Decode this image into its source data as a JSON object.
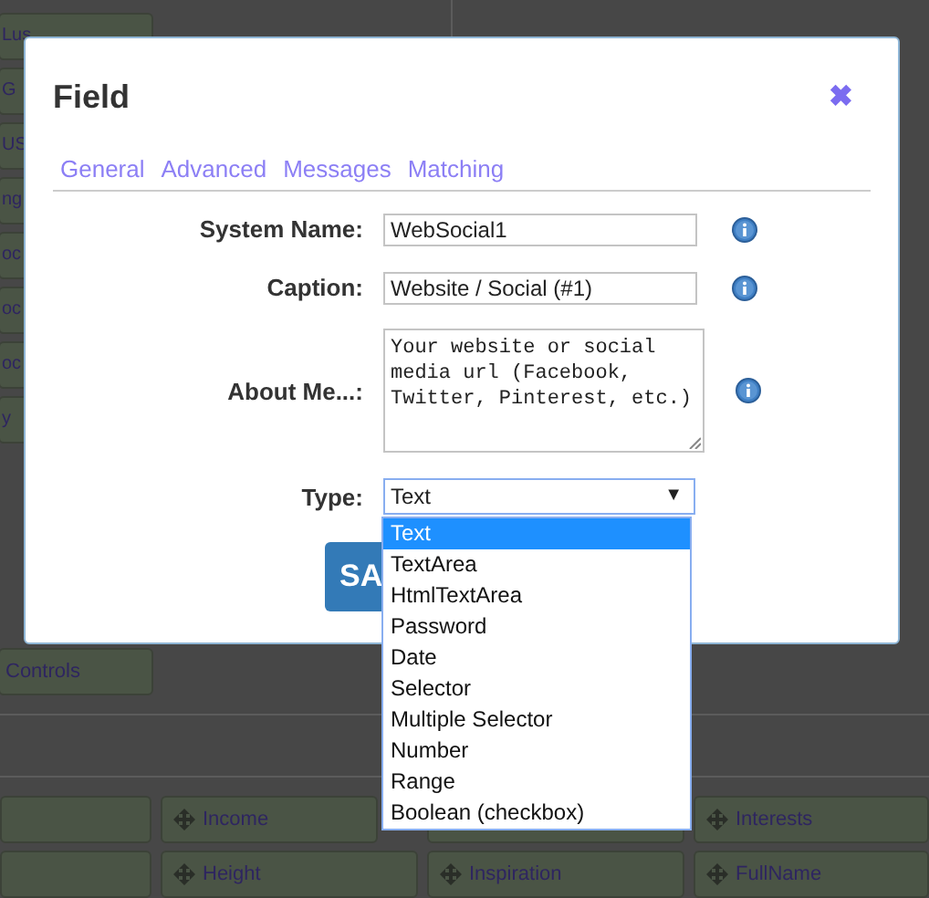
{
  "background": {
    "side_items": [
      "Lus",
      "G",
      "US",
      "ng",
      "oc",
      "oc",
      "oc",
      "y"
    ],
    "controls_label": "Controls",
    "tiles": [
      {
        "kind": "blank"
      },
      {
        "kind": "field",
        "label": "Income"
      },
      {
        "kind": "blank"
      },
      {
        "kind": "field",
        "label": "Interests"
      },
      {
        "kind": "blank"
      },
      {
        "kind": "field",
        "label": "Height"
      },
      {
        "kind": "field",
        "label": "Inspiration"
      },
      {
        "kind": "field",
        "label": "FullName"
      }
    ]
  },
  "dialog": {
    "title": "Field",
    "close": "✖",
    "tabs": [
      {
        "label": "General",
        "selected": false
      },
      {
        "label": "Advanced",
        "selected": false
      },
      {
        "label": "Messages",
        "selected": false
      },
      {
        "label": "Matching",
        "selected": false
      }
    ],
    "fields": [
      {
        "kind": "input",
        "label": "System Name:",
        "value": "WebSocial1"
      },
      {
        "kind": "input",
        "label": "Caption:",
        "value": "Website / Social (#1)"
      },
      {
        "kind": "textarea",
        "label": "About Me...:",
        "value": "Your website or social media url (Facebook, Twitter, Pinterest, etc.)"
      },
      {
        "kind": "select",
        "label": "Type:",
        "value": "Text",
        "caret": "▼"
      }
    ],
    "save_button": "SA"
  },
  "type_options": [
    {
      "label": "Text",
      "selected": true
    },
    {
      "label": "TextArea",
      "selected": false
    },
    {
      "label": "HtmlTextArea",
      "selected": false
    },
    {
      "label": "Password",
      "selected": false
    },
    {
      "label": "Date",
      "selected": false
    },
    {
      "label": "Selector",
      "selected": false
    },
    {
      "label": "Multiple Selector",
      "selected": false
    },
    {
      "label": "Number",
      "selected": false
    },
    {
      "label": "Range",
      "selected": false
    },
    {
      "label": "Boolean (checkbox)",
      "selected": false
    }
  ]
}
